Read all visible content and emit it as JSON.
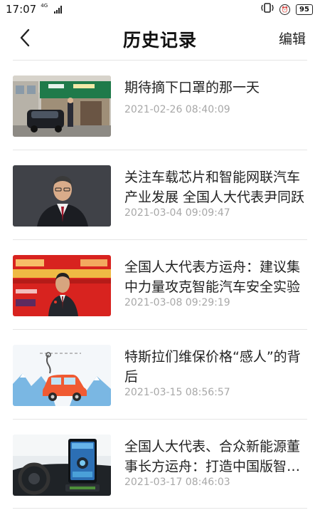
{
  "status_bar": {
    "time": "17:07",
    "network": "4G",
    "battery": "95"
  },
  "header": {
    "back_icon": "chevron-left-icon",
    "title": "历史记录",
    "edit_label": "编辑"
  },
  "history": [
    {
      "title": "期待摘下口罩的那一天",
      "time": "2021-02-26 08:40:09",
      "thumb_icon": "post-office-street-photo"
    },
    {
      "title": "关注车载芯片和智能网联汽车产业发展 全国人大代表尹同跃",
      "time": "2021-03-04 09:09:47",
      "thumb_icon": "man-portrait-photo"
    },
    {
      "title": "全国人大代表方运舟：建议集中力量攻克智能汽车安全实验",
      "time": "2021-03-08 09:29:19",
      "thumb_icon": "red-banner-interview-photo"
    },
    {
      "title": "特斯拉们维保价格“感人”的背后",
      "time": "2021-03-15 08:56:57",
      "thumb_icon": "car-wrench-illustration"
    },
    {
      "title": "全国人大代表、合众新能源董事长方运舟：打造中国版智能汽车",
      "time": "2021-03-17 08:46:03",
      "thumb_icon": "car-dashboard-screen-photo"
    }
  ]
}
